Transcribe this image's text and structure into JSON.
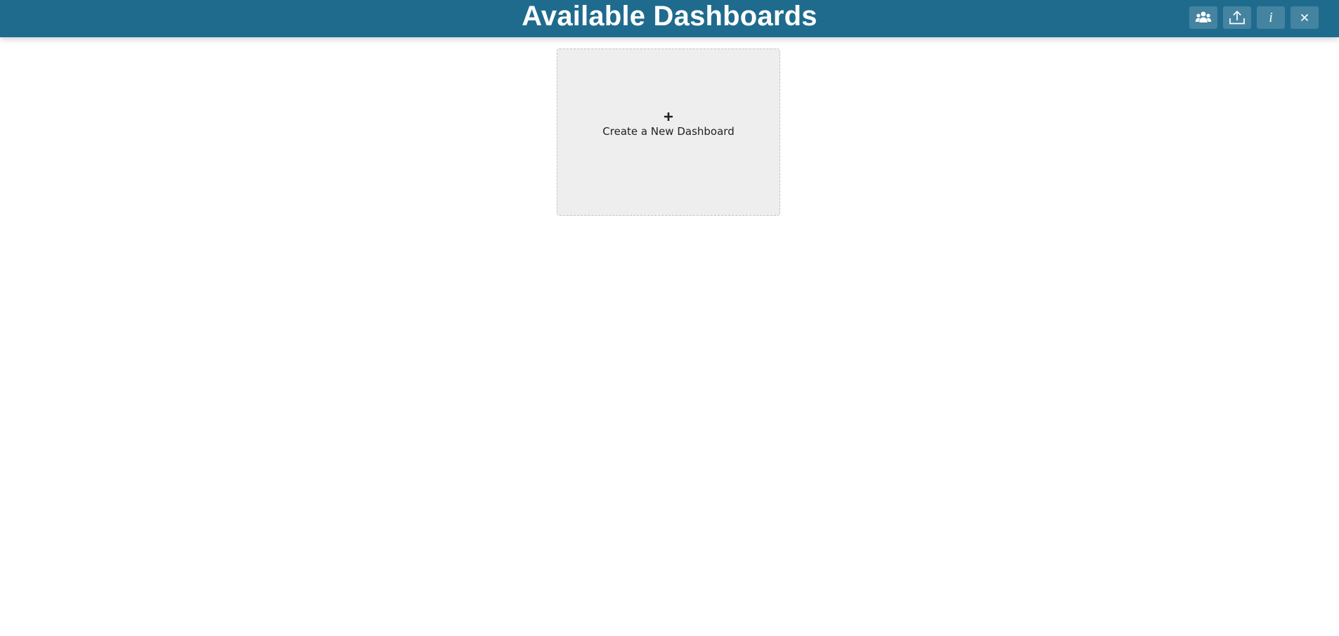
{
  "header": {
    "title": "Available Dashboards",
    "background_color": "#1f6b8e",
    "buttons": [
      {
        "name": "share",
        "icon": "users-icon"
      },
      {
        "name": "upload",
        "icon": "upload-icon"
      },
      {
        "name": "info",
        "icon": "info-icon",
        "glyph": "i"
      },
      {
        "name": "close",
        "icon": "close-icon",
        "glyph": "✕"
      }
    ]
  },
  "main": {
    "create_card": {
      "icon": "plus-icon",
      "label": "Create a New Dashboard",
      "background_color": "#eeeeee"
    }
  }
}
